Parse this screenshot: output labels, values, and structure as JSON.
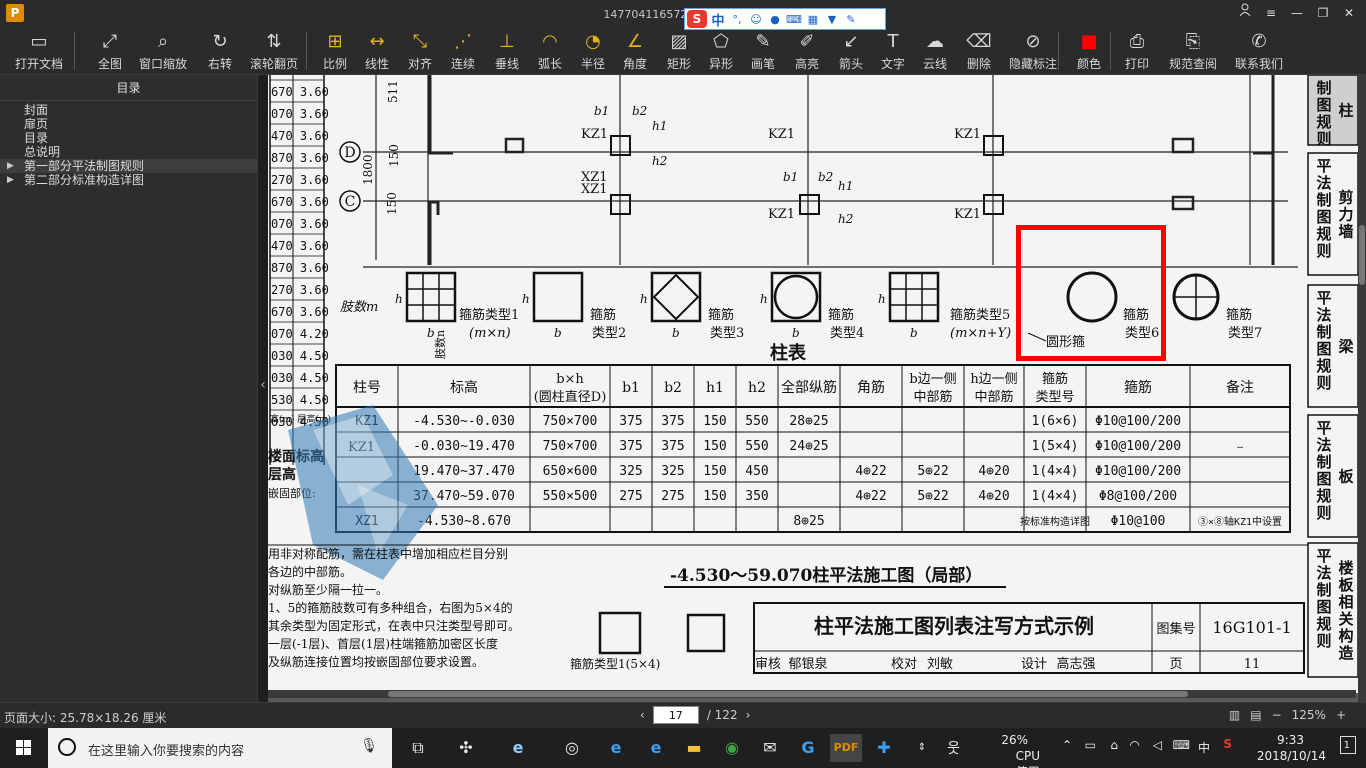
{
  "window": {
    "title": "1477041165722.pdf - PDF 快",
    "app_logo": "P",
    "controls": [
      "user-icon",
      "menu-icon",
      "minimize-icon",
      "restore-icon",
      "close-icon"
    ]
  },
  "ime": {
    "logo": "S",
    "mode": "中",
    "punct": "°,",
    "items": [
      "smiley-icon",
      "mic-icon",
      "keyboard-icon",
      "grid-icon",
      "shirt-icon",
      "wrench-icon"
    ]
  },
  "toolbar": {
    "items": [
      {
        "id": "open",
        "label": "打开文档"
      },
      {
        "id": "fullpage",
        "label": "全图"
      },
      {
        "id": "zoomwin",
        "label": "窗口缩放"
      },
      {
        "id": "rotate",
        "label": "右转"
      },
      {
        "id": "scroll",
        "label": "滚轮翻页"
      },
      {
        "id": "scale",
        "label": "比例"
      },
      {
        "id": "linear",
        "label": "线性"
      },
      {
        "id": "aligned",
        "label": "对齐"
      },
      {
        "id": "continuous",
        "label": "连续"
      },
      {
        "id": "perp",
        "label": "垂线"
      },
      {
        "id": "arc",
        "label": "弧长"
      },
      {
        "id": "radius",
        "label": "半径"
      },
      {
        "id": "angle",
        "label": "角度"
      },
      {
        "id": "rect",
        "label": "矩形"
      },
      {
        "id": "shape",
        "label": "异形"
      },
      {
        "id": "pen",
        "label": "画笔"
      },
      {
        "id": "highlight",
        "label": "高亮"
      },
      {
        "id": "arrow",
        "label": "箭头"
      },
      {
        "id": "text",
        "label": "文字"
      },
      {
        "id": "cloud",
        "label": "云线"
      },
      {
        "id": "delete",
        "label": "删除"
      },
      {
        "id": "hide",
        "label": "隐藏标注"
      },
      {
        "id": "color",
        "label": "颜色"
      },
      {
        "id": "print",
        "label": "打印"
      },
      {
        "id": "spec",
        "label": "规范查阅"
      },
      {
        "id": "contact",
        "label": "联系我们"
      }
    ]
  },
  "sidebar": {
    "header": "目录",
    "items": [
      {
        "label": "封面",
        "arrow": ""
      },
      {
        "label": "扉页",
        "arrow": ""
      },
      {
        "label": "目录",
        "arrow": ""
      },
      {
        "label": "总说明",
        "arrow": ""
      },
      {
        "label": "第一部分平法制图规则",
        "arrow": "▶"
      },
      {
        "label": "第二部分标准构造详图",
        "arrow": "▶"
      }
    ]
  },
  "drawing": {
    "elev_rows": [
      "670 3.60",
      "070 3.60",
      "470 3.60",
      "870 3.60",
      "270 3.60",
      "670 3.60",
      "070 3.60",
      "470 3.60",
      "870 3.60",
      "270 3.60",
      "670 3.60",
      "070 4.20",
      "030 4.50",
      "030 4.50",
      "530 4.50",
      "030 4.50"
    ],
    "elev_footer": "高(m) 层高(m)",
    "axis_d": "D",
    "axis_c": "C",
    "dims": [
      "511",
      "1800",
      "150",
      "150"
    ],
    "col_labels": [
      "KZ1",
      "KZ1",
      "KZ1",
      "XZ1",
      "XZ1",
      "KZ1",
      "KZ1"
    ],
    "dim_symbols": [
      "b1",
      "b2",
      "h1",
      "h2",
      "b1",
      "b2",
      "h1",
      "h2"
    ],
    "limb_label": "肢数m",
    "bh": [
      "h",
      "b"
    ],
    "stirrup_types": [
      {
        "a": "箍筋类型1",
        "b": "(m×n)"
      },
      {
        "a": "箍筋",
        "b": "类型2"
      },
      {
        "a": "箍筋",
        "b": "类型3"
      },
      {
        "a": "箍筋",
        "b": "类型4"
      },
      {
        "a": "箍筋类型5",
        "b": "(m×n+Y)"
      },
      {
        "a": "箍筋",
        "b": "类型6"
      },
      {
        "a": "箍筋",
        "b": "类型7"
      }
    ],
    "circle_stirrup": "圆形箍",
    "limb_side": "肢数n",
    "table_title": "柱表",
    "headers": [
      "柱号",
      "标高",
      "b×h",
      "(圆柱直径D)",
      "b1",
      "b2",
      "h1",
      "h2",
      "全部纵筋",
      "角筋",
      "b边一侧",
      "中部筋",
      "h边一侧",
      "中部筋",
      "箍筋",
      "类型号",
      "箍筋",
      "备注"
    ],
    "rows": [
      [
        "KZ1",
        "-4.530~-0.030",
        "750×700",
        "375",
        "375",
        "150",
        "550",
        "28⊕25",
        "",
        "",
        "",
        "1(6×6)",
        "Φ10@100/200",
        ""
      ],
      [
        "",
        "-0.030~19.470",
        "750×700",
        "375",
        "375",
        "150",
        "550",
        "24⊕25",
        "",
        "",
        "",
        "1(5×4)",
        "Φ10@100/200",
        "—"
      ],
      [
        "",
        "19.470~37.470",
        "650×600",
        "325",
        "325",
        "150",
        "450",
        "",
        "4⊕22",
        "5⊕22",
        "4⊕20",
        "1(4×4)",
        "Φ10@100/200",
        ""
      ],
      [
        "",
        "37.470~59.070",
        "550×500",
        "275",
        "275",
        "150",
        "350",
        "",
        "4⊕22",
        "5⊕22",
        "4⊕20",
        "1(4×4)",
        "Φ8@100/200",
        ""
      ],
      [
        "XZ1",
        "-4.530~8.670",
        "",
        "",
        "",
        "",
        "",
        "8⊕25",
        "",
        "",
        "",
        "按标准构造详图",
        "Φ10@100",
        "③×⑧轴KZ1中设置"
      ]
    ],
    "left_labels": [
      "楼面标高",
      "层高",
      "嵌固部位:"
    ],
    "left_kz1": "KZ1",
    "notes": [
      "用非对称配筋，需在柱表中增加相应栏目分别",
      "各边的中部筋。",
      "对纵筋至少隔一拉一。",
      "1、5的箍筋肢数可有多种组合，右图为5×4的",
      "其余类型为固定形式，在表中只注类型号即可。",
      "一层(-1层)、首层(1层)柱端箍筋加密区长度",
      "及纵筋连接位置均按嵌固部位要求设置。"
    ],
    "drawing_title": "-4.530～59.070柱平法施工图（局部）",
    "stirrup_small": "箍筋类型1(5×4)",
    "title_block": {
      "title": "柱平法施工图列表注写方式示例",
      "atlas_label": "图集号",
      "atlas_no": "16G101-1",
      "review": "审核",
      "reviewer": "郁银泉",
      "check": "校对",
      "checker": "刘敏",
      "design": "设计",
      "designer": "高志强",
      "page_label": "页",
      "page_no": "11"
    },
    "side_tabs": [
      {
        "text": "制图规则",
        "side": "柱"
      },
      {
        "text": "平法制图规则",
        "side": "剪力墙"
      },
      {
        "text": "平法制图规则",
        "side": "梁"
      },
      {
        "text": "平法制图规则",
        "side": "板"
      },
      {
        "text": "平法制图规则",
        "side": "楼板相关构造"
      }
    ]
  },
  "status": {
    "page_size": "页面大小: 25.78×18.26 厘米",
    "current_page": "17",
    "total_pages": "/ 122",
    "zoom": "125%"
  },
  "taskbar": {
    "search_placeholder": "在这里输入你要搜索的内容",
    "cpu_percent": "26%",
    "cpu_label": "CPU使用",
    "ime_lang": "中",
    "time": "9:33",
    "date": "2018/10/14",
    "notif_count": "1"
  }
}
